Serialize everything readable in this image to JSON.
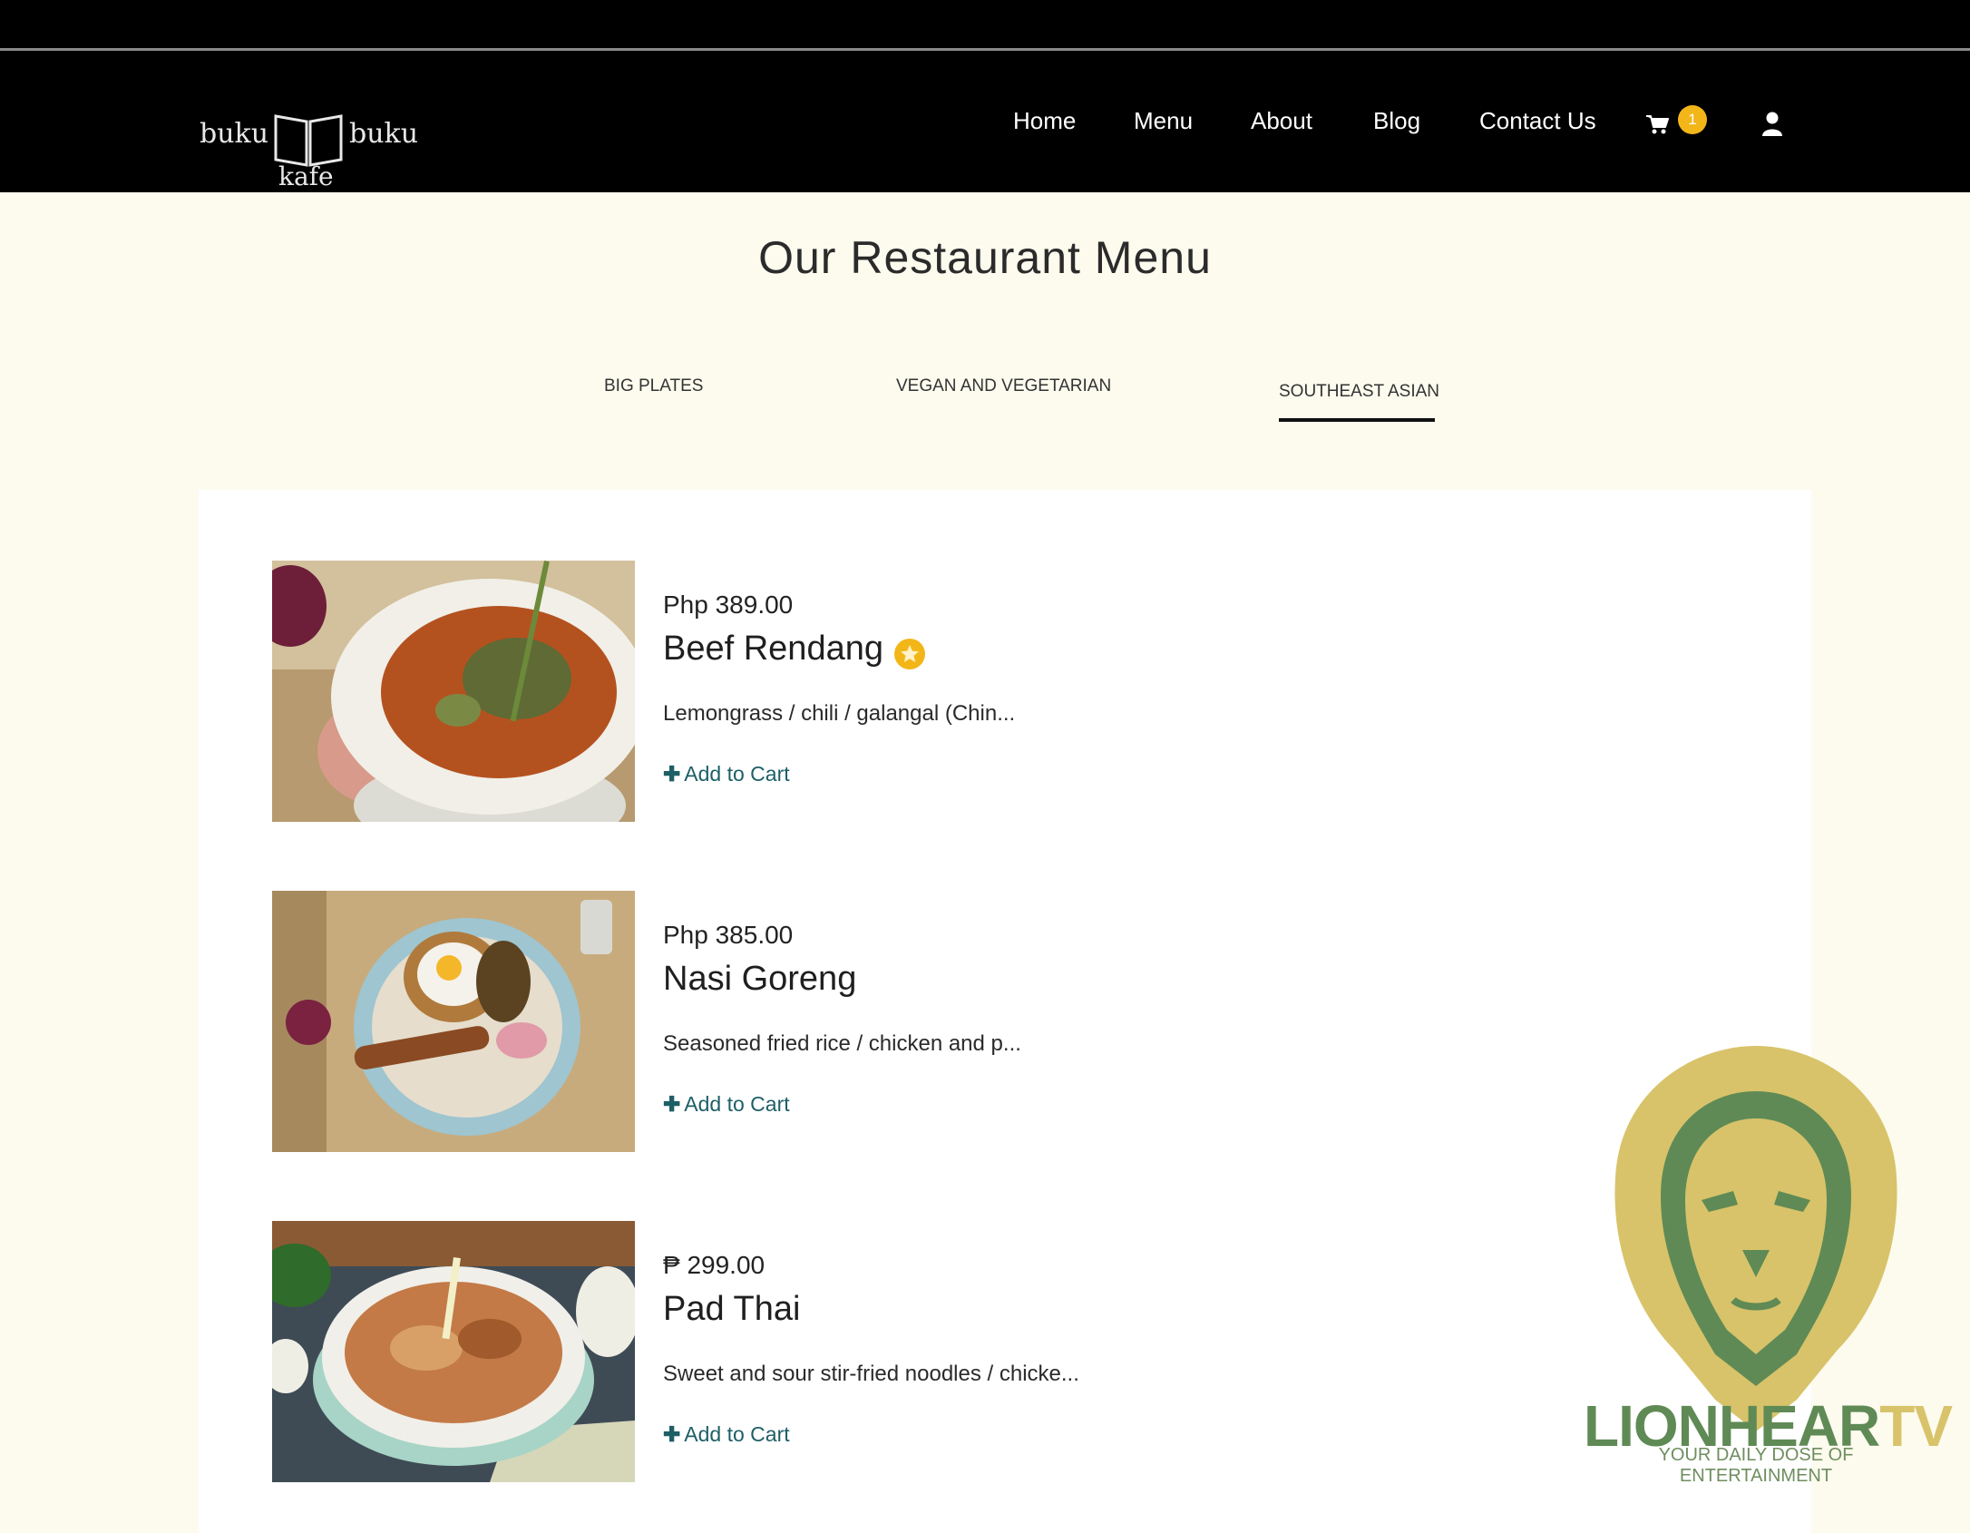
{
  "logo": {
    "word_left": "buku",
    "word_right": "buku",
    "word_bottom": "kafe"
  },
  "nav": {
    "home": "Home",
    "menu": "Menu",
    "about": "About",
    "blog": "Blog",
    "contact": "Contact Us",
    "cart_count": "1"
  },
  "page": {
    "title": "Our Restaurant Menu"
  },
  "tabs": [
    {
      "label": "BIG PLATES",
      "active": false
    },
    {
      "label": "VEGAN AND VEGETARIAN",
      "active": false
    },
    {
      "label": "SOUTHEAST ASIAN",
      "active": true
    }
  ],
  "items": [
    {
      "price": "Php 389.00",
      "name": "Beef Rendang",
      "featured": true,
      "description": "Lemongrass / chili / galangal (Chin...",
      "add_label": "Add to Cart"
    },
    {
      "price": "Php 385.00",
      "name": "Nasi Goreng",
      "featured": false,
      "description": "Seasoned fried rice / chicken and p...",
      "add_label": "Add to Cart"
    },
    {
      "price": "₱ 299.00",
      "name": "Pad Thai",
      "featured": false,
      "description": "Sweet and sour stir-fried noodles / chicke...",
      "add_label": "Add to Cart"
    }
  ],
  "watermark": {
    "brand_part1": "LIONHEAR",
    "brand_part2": "TV",
    "tagline": "YOUR DAILY DOSE OF ENTERTAINMENT"
  },
  "colors": {
    "background": "#fcfbee",
    "navbar": "#000000",
    "accent": "#f3b619",
    "link": "#1d5f66"
  }
}
